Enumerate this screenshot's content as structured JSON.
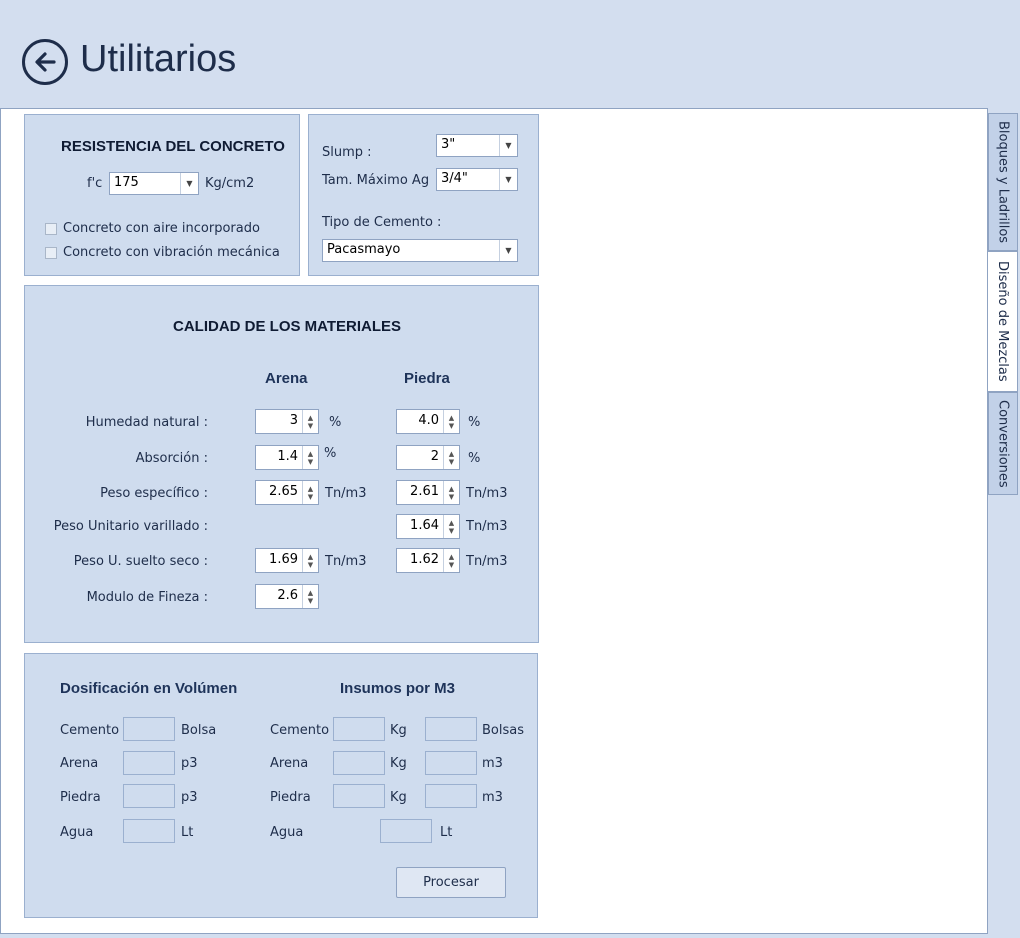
{
  "header": {
    "title": "Utilitarios"
  },
  "tabs": [
    {
      "label": "Bloques y Ladrillos",
      "active": false
    },
    {
      "label": "Diseño de Mezclas",
      "active": true
    },
    {
      "label": "Conversiones",
      "active": false
    }
  ],
  "resistencia": {
    "title": "RESISTENCIA DEL CONCRETO",
    "fc_label": "f'c",
    "fc_value": "175",
    "fc_unit": "Kg/cm2",
    "check_aire": "Concreto con aire incorporado",
    "check_vibracion": "Concreto con vibración mecánica"
  },
  "params": {
    "slump_label": "Slump  :",
    "slump_value": "3\"",
    "tam_label": "Tam. Máximo Ag",
    "tam_value": "3/4\"",
    "cemento_label": "Tipo de Cemento :",
    "cemento_value": "Pacasmayo"
  },
  "materiales": {
    "title": "CALIDAD DE LOS MATERIALES",
    "col_arena": "Arena",
    "col_piedra": "Piedra",
    "humedad_label": "Humedad natural :",
    "humedad_arena": "3",
    "humedad_arena_unit": "%",
    "humedad_piedra": "4.0",
    "humedad_piedra_unit": "%",
    "absorcion_label": "Absorción :",
    "absorcion_arena": "1.4",
    "absorcion_arena_unit": "%",
    "absorcion_piedra": "2",
    "absorcion_piedra_unit": "%",
    "peso_esp_label": "Peso específico :",
    "peso_esp_arena": "2.65",
    "peso_esp_arena_unit": "Tn/m3",
    "peso_esp_piedra": "2.61",
    "peso_esp_piedra_unit": "Tn/m3",
    "peso_var_label": "Peso Unitario varillado :",
    "peso_var_piedra": "1.64",
    "peso_var_piedra_unit": "Tn/m3",
    "peso_sue_label": "Peso U. suelto seco :",
    "peso_sue_arena": "1.69",
    "peso_sue_arena_unit": "Tn/m3",
    "peso_sue_piedra": "1.62",
    "peso_sue_piedra_unit": "Tn/m3",
    "modulo_label": "Modulo de Fineza :",
    "modulo_arena": "2.6"
  },
  "resultados": {
    "dos_title": "Dosificación en Volúmen",
    "ins_title": "Insumos por M3",
    "cemento": "Cemento",
    "arena": "Arena",
    "piedra": "Piedra",
    "agua": "Agua",
    "u_bolsa": "Bolsa",
    "u_p3": "p3",
    "u_lt": "Lt",
    "u_kg": "Kg",
    "u_bolsas": "Bolsas",
    "u_m3": "m3",
    "procesar": "Procesar"
  }
}
